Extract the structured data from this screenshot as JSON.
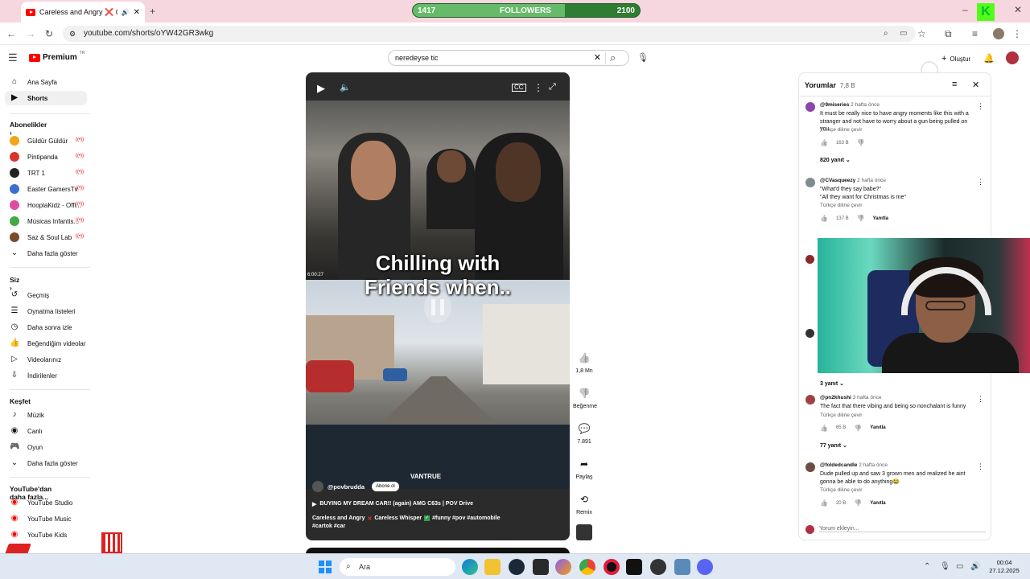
{
  "browser": {
    "tab_title": "Careless and Angry ❌ Care",
    "url": "youtube.com/shorts/oYW42GR3wkg"
  },
  "overlay": {
    "followers_left": "1417",
    "followers_label": "FOLLOWERS",
    "followers_right": "2100",
    "followers_progress": 0.67
  },
  "youtube": {
    "logo_text": "Premium",
    "logo_region": "TR",
    "search_value": "neredeyse  tic",
    "create_label": "Oluştur"
  },
  "sidebar": {
    "main": [
      {
        "label": "Ana Sayfa",
        "icon": "home-icon"
      },
      {
        "label": "Shorts",
        "icon": "shorts-icon"
      }
    ],
    "subs_header": "Abonelikler",
    "subs": [
      {
        "label": "Güldür Güldür",
        "color": "#f2a51a"
      },
      {
        "label": "Pintipanda",
        "color": "#d9342b"
      },
      {
        "label": "TRT 1",
        "color": "#222222"
      },
      {
        "label": "Easter GamersTv",
        "color": "#3b6fd1"
      },
      {
        "label": "HooplaKidz - Offi...",
        "color": "#e04da0"
      },
      {
        "label": "Músicas Infantis...",
        "color": "#45a845"
      },
      {
        "label": "Saz & Soul Lab",
        "color": "#7a4a2a"
      }
    ],
    "subs_more": "Daha fazla göster",
    "you_header": "Siz",
    "you": [
      {
        "label": "Geçmiş",
        "icon": "history-icon"
      },
      {
        "label": "Oynatma listeleri",
        "icon": "playlist-icon"
      },
      {
        "label": "Daha sonra izle",
        "icon": "watch-later-icon"
      },
      {
        "label": "Beğendiğim videolar",
        "icon": "thumbs-up-icon"
      },
      {
        "label": "Videolarınız",
        "icon": "video-icon"
      },
      {
        "label": "İndirilenler",
        "icon": "download-icon"
      }
    ],
    "explore_header": "Keşfet",
    "explore": [
      {
        "label": "Müzik",
        "icon": "music-icon"
      },
      {
        "label": "Canlı",
        "icon": "live-icon"
      },
      {
        "label": "Oyun",
        "icon": "gaming-icon"
      }
    ],
    "explore_more": "Daha fazla göster",
    "more_header": "YouTube'dan daha fazla...",
    "more": [
      {
        "label": "YouTube Studio"
      },
      {
        "label": "YouTube Music"
      },
      {
        "label": "YouTube Kids"
      }
    ]
  },
  "video": {
    "caption_line1": "Chilling with",
    "caption_line2": "Friends when..",
    "timestamp": "6:00:27",
    "dashcam_brand": "VANTRUE",
    "channel": "@povbrudda",
    "subscribe_label": "Abone ol",
    "title": "BUYING MY DREAM CAR!! (again) AMG C63s | POV Drive",
    "desc_line1_a": "Careless and Angry",
    "desc_line1_b": "Careless Whisper",
    "desc_line1_tags": "#funny #pov #automobile",
    "desc_line2": "#cartok #car"
  },
  "actions": [
    {
      "label": "1,8 Mn",
      "icon": "like-icon"
    },
    {
      "label": "Beğenme",
      "icon": "dislike-icon"
    },
    {
      "label": "7.891",
      "icon": "comment-icon"
    },
    {
      "label": "Paylaş",
      "icon": "share-icon"
    },
    {
      "label": "Remix",
      "icon": "remix-icon"
    }
  ],
  "comments": {
    "title": "Yorumlar",
    "count": "7,8 B",
    "translate_label": "Türkçe diline çevir",
    "reply_label": "Yanıtla",
    "add_placeholder": "Yorum ekleyin...",
    "items": [
      {
        "author": "@9miseries",
        "time": "2 hafta önce",
        "text": "It must be really nice to have angry moments like this with a stranger and not have to worry about a gun being pulled on you.",
        "likes": "163 B",
        "replies": "820 yanıt",
        "color": "#8e44ad"
      },
      {
        "author": "@CVasqueezy",
        "time": "2 hafta önce",
        "text": "\"What'd they say babe?\"\n\"All they want for Christmas is me\"",
        "likes": "137 B",
        "color": "#7f8c8d"
      },
      {
        "replies": "3 yanıt"
      },
      {
        "author": "@pn2khushi",
        "time": "3 hafta önce",
        "text": "The fact that there vibing and being so nonchalant is funny",
        "likes": "65 B",
        "replies": "77 yanıt",
        "color": "#a04040"
      },
      {
        "author": "@foldedcandle",
        "time": "2 hafta önce",
        "text": "Dude pulled up and saw 3 grown men and realized he aint gonna be able to do anything😂",
        "likes": "20 B",
        "color": "#6d4c41"
      }
    ]
  },
  "taskbar": {
    "search_placeholder": "Ara",
    "time": "00:04",
    "date": "27.12.2025"
  }
}
